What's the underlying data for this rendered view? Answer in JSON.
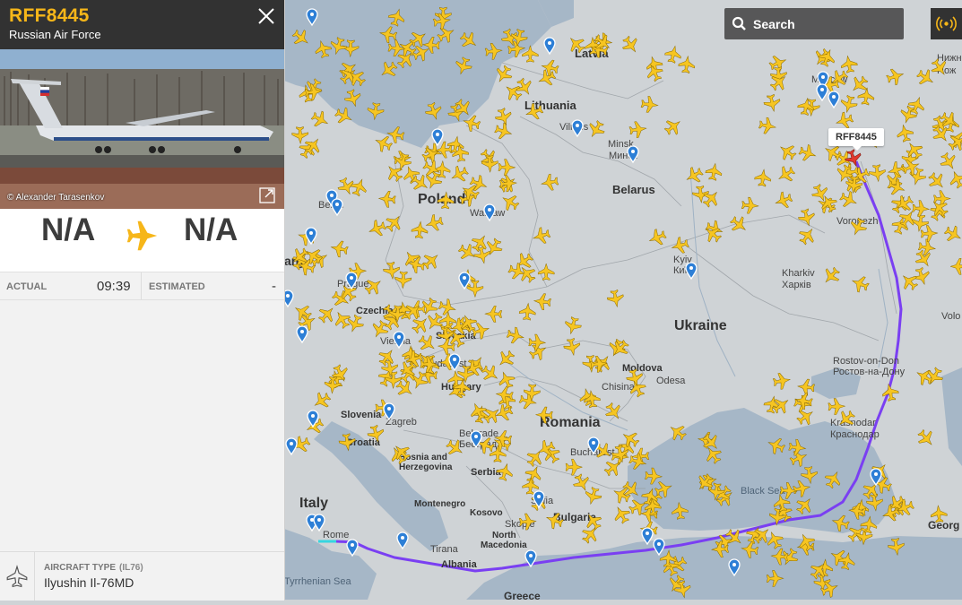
{
  "flight": {
    "callsign": "RFF8445",
    "operator": "Russian Air Force",
    "photo_credit": "© Alexander Tarasenkov",
    "origin": "N/A",
    "destination": "N/A",
    "actual_label": "ACTUAL",
    "actual_time": "09:39",
    "estimated_label": "ESTIMATED",
    "estimated_time": "-",
    "aircraft_type_label": "AIRCRAFT TYPE",
    "aircraft_code": "(IL76)",
    "aircraft_name": "Ilyushin Il-76MD"
  },
  "search": {
    "placeholder": "Search"
  },
  "map": {
    "flight_tag": "RFF8445",
    "countries": [
      "Latvia",
      "Lithuania",
      "Belarus",
      "Poland",
      "Ukraine",
      "Moldova",
      "Romania",
      "Slovakia",
      "Hungary",
      "Slovenia",
      "Croatia",
      "Bosnia and Herzegovina",
      "Serbia",
      "Montenegro",
      "Kosovo",
      "North Macedonia",
      "Albania",
      "Bulgaria",
      "Italy",
      "Greece",
      "Czechia",
      "Georgia"
    ],
    "cities": [
      "Moscow",
      "Minsk",
      "Минск",
      "Vilnius",
      "Warsaw",
      "Kyiv",
      "Київ",
      "Kharkiv",
      "Харків",
      "Voronezh",
      "Rostov-on-Don",
      "Ростов-на-Дону",
      "Krasnodar",
      "Краснодар",
      "Odesa",
      "Chisinau",
      "Bucharest",
      "Sofia",
      "Belgrade",
      "Београд",
      "Budapest",
      "Vienna",
      "Prague",
      "Zagreb",
      "Tirana",
      "Skopje",
      "Rome",
      "Berlin"
    ],
    "seas": [
      "Black Sea",
      "Tyrrhenian Sea"
    ],
    "edge_labels": [
      "any",
      "Нижн",
      "Нож",
      "Volo",
      "Georg"
    ],
    "colors": {
      "land": "#d3d6d9",
      "water": "#9fb2c4",
      "track": "#7a3ff2",
      "plane": "#f6c521",
      "accent": "#f6b619"
    }
  }
}
